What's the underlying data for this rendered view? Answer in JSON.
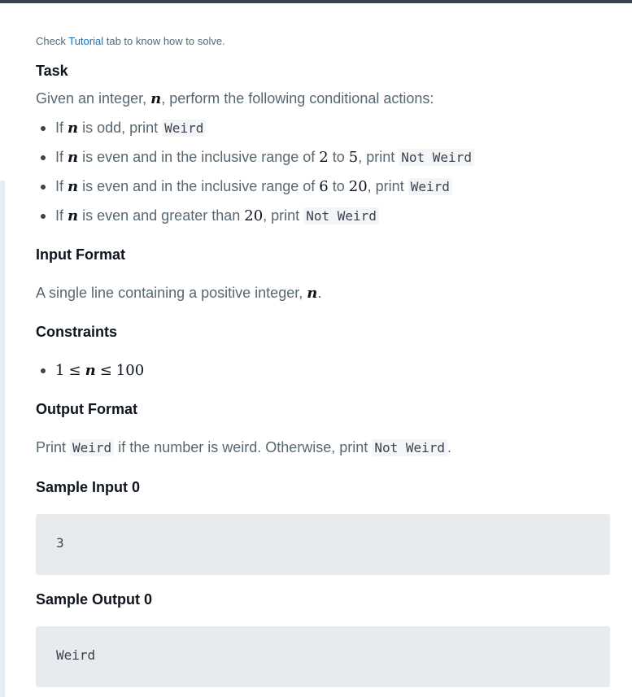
{
  "hint": {
    "prefix": "Check ",
    "link": "Tutorial",
    "suffix": " tab to know how to solve."
  },
  "task": {
    "heading": "Task",
    "intro_a": "Given an integer, ",
    "var": "n",
    "intro_b": ", perform the following conditional actions:",
    "rules": [
      {
        "t1": "If ",
        "v": "n",
        "t2": " is odd, print ",
        "code": "Weird"
      },
      {
        "t1": "If ",
        "v": "n",
        "t2": " is even and in the inclusive range of ",
        "a": "2",
        "mid": " to ",
        "b": "5",
        "t3": ", print ",
        "code": "Not Weird"
      },
      {
        "t1": "If ",
        "v": "n",
        "t2": " is even and in the inclusive range of ",
        "a": "6",
        "mid": " to ",
        "b": "20",
        "t3": ", print ",
        "code": "Weird"
      },
      {
        "t1": "If ",
        "v": "n",
        "t2": " is even and greater than ",
        "a": "20",
        "t3": ", print ",
        "code": "Not Weird"
      }
    ]
  },
  "input_format": {
    "heading": "Input Format",
    "text_a": "A single line containing a positive integer, ",
    "var": "n",
    "text_b": "."
  },
  "constraints": {
    "heading": "Constraints",
    "low": "1",
    "le1": "≤",
    "var": "n",
    "le2": "≤",
    "high": "100"
  },
  "output_format": {
    "heading": "Output Format",
    "t1": "Print ",
    "code1": "Weird",
    "t2": " if the number is weird. Otherwise, print ",
    "code2": "Not Weird",
    "t3": "."
  },
  "sample_input": {
    "heading": "Sample Input 0",
    "value": "3"
  },
  "sample_output": {
    "heading": "Sample Output 0",
    "value": "Weird"
  }
}
